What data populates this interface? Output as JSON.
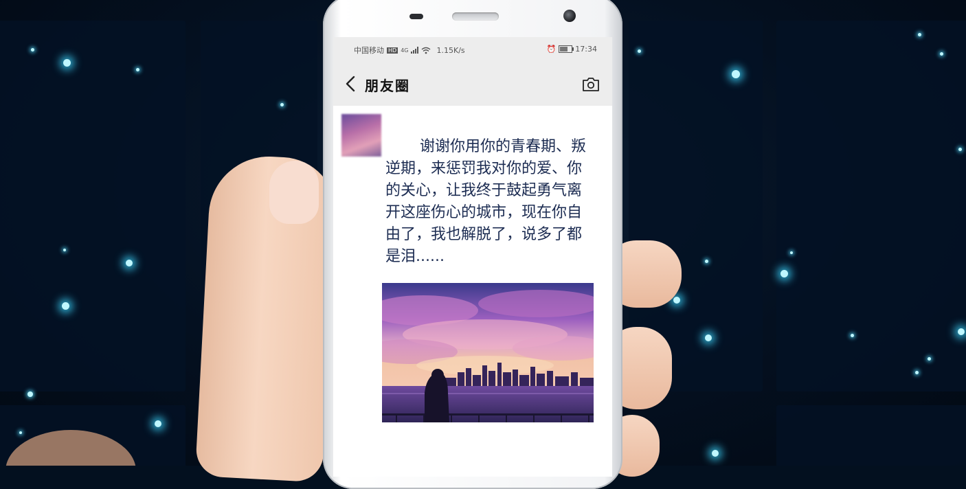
{
  "status_bar": {
    "carrier": "中国移动",
    "net_badge": "HD",
    "network_type": "4G",
    "speed": "1.15K/s",
    "time": "17:34"
  },
  "nav": {
    "title": "朋友圈"
  },
  "post": {
    "text": "谢谢你用你的青春期、叛逆期，来惩罚我对你的爱、你的关心，让我终于鼓起勇气离开这座伤心的城市，现在你自由了，我也解脱了，说多了都是泪......"
  },
  "colors": {
    "background": "#03101f",
    "star_glow": "#50dcff",
    "bar_bg": "#ededed",
    "post_text": "#1c2c52"
  },
  "icons": [
    "back-icon",
    "camera-icon",
    "wifi-icon",
    "signal-icon",
    "battery-icon",
    "alarm-icon"
  ]
}
